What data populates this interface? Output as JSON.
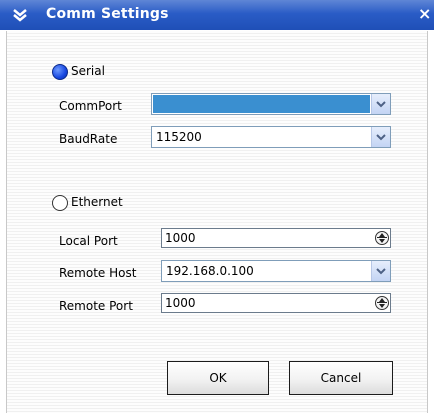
{
  "window": {
    "title": "Comm Settings",
    "close_glyph": "×"
  },
  "serial": {
    "radio_label": "Serial",
    "selected": true,
    "commport_label": "CommPort",
    "commport_value": "",
    "baudrate_label": "BaudRate",
    "baudrate_value": "115200"
  },
  "ethernet": {
    "radio_label": "Ethernet",
    "selected": false,
    "local_port_label": "Local Port",
    "local_port_value": "1000",
    "remote_host_label": "Remote Host",
    "remote_host_value": "192.168.0.100",
    "remote_port_label": "Remote Port",
    "remote_port_value": "1000"
  },
  "buttons": {
    "ok_label": "OK",
    "cancel_label": "Cancel"
  },
  "icons": {
    "title": "window-menu-icon",
    "dropdown": "chevron-down-icon",
    "spinner": "spinner-updown-icon"
  },
  "colors": {
    "titlebar": "#2a5cc6",
    "selection": "#3a8fd0",
    "radio_on": "#1747e0"
  }
}
